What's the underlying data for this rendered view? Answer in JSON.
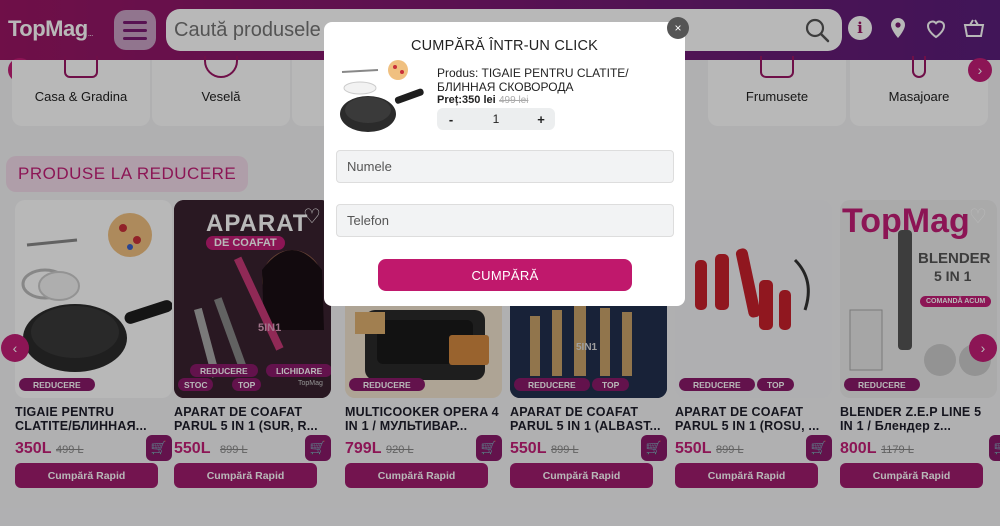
{
  "header": {
    "logo": "TopMag",
    "logo_suffix": "...",
    "search_placeholder": "Caută produsele",
    "icons": [
      "menu-icon",
      "search-icon",
      "info-icon",
      "location-icon",
      "wishlist-icon",
      "cart-icon"
    ],
    "wishlist_count": "0",
    "cart_count": "0"
  },
  "categories": [
    {
      "label": "Casa & Gradina"
    },
    {
      "label": "Veselă"
    },
    {
      "label": "Frumusete"
    },
    {
      "label": "Masajoare"
    }
  ],
  "section": {
    "title": "PRODUSE LA REDUCERE"
  },
  "product_common": {
    "buy_label": "Cumpără Rapid",
    "badge_sale": "REDUCERE",
    "badge_top": "TOP"
  },
  "products": [
    {
      "name": "TIGAIE PENTRU CLATITE/БЛИННАЯ...",
      "price": "350L",
      "old_price": "499 L"
    },
    {
      "name": "APARAT DE COAFAT PARUL 5 IN 1 (SUR, R...",
      "price": "550L",
      "old_price": "899 L",
      "img_title": "APARAT",
      "img_sub": "DE COAFAT",
      "img_tags": [
        "REDUCERE",
        "LICHIDARE",
        "STOC",
        "TOP"
      ],
      "img_badge": "5IN1",
      "img_brand": "TopMag"
    },
    {
      "name": "MULTICOOKER OPERA 4 IN 1 / МУЛЬТИВАР...",
      "price": "799L",
      "old_price": "920 L"
    },
    {
      "name": "APARAT DE COAFAT PARUL 5 IN 1 (ALBAST...",
      "price": "550L",
      "old_price": "899 L",
      "img_badge": "5IN1"
    },
    {
      "name": "APARAT DE COAFAT PARUL 5 IN 1 (ROSU, ...",
      "price": "550L",
      "old_price": "899 L"
    },
    {
      "name": "BLENDER Z.E.P LINE 5 IN 1 / Блендер z...",
      "price": "800L",
      "old_price": "1179 L",
      "img_brand": "TopMag",
      "img_title": "BLENDER",
      "img_sub": "5 IN 1",
      "img_cta": "COMANDĂ ACUM"
    }
  ],
  "modal": {
    "title": "CUMPĂRĂ ÎNTR-UN CLICK",
    "product_prefix": "Produs:",
    "product_name": "TIGAIE PENTRU CLATITE/ БЛИННАЯ СКОВОРОДА",
    "price_label": "Preț:350 lei",
    "old_price": "499 lei",
    "qty_minus": "-",
    "qty_value": "1",
    "qty_plus": "+",
    "name_placeholder": "Numele",
    "phone_placeholder": "Telefon",
    "buy_label": "CUMPĂRĂ",
    "close": "×"
  },
  "colors": {
    "brand": "#c21e77",
    "brand_dark": "#8a1a6a",
    "header_start": "#9a1664",
    "header_end": "#5a1e7a"
  }
}
